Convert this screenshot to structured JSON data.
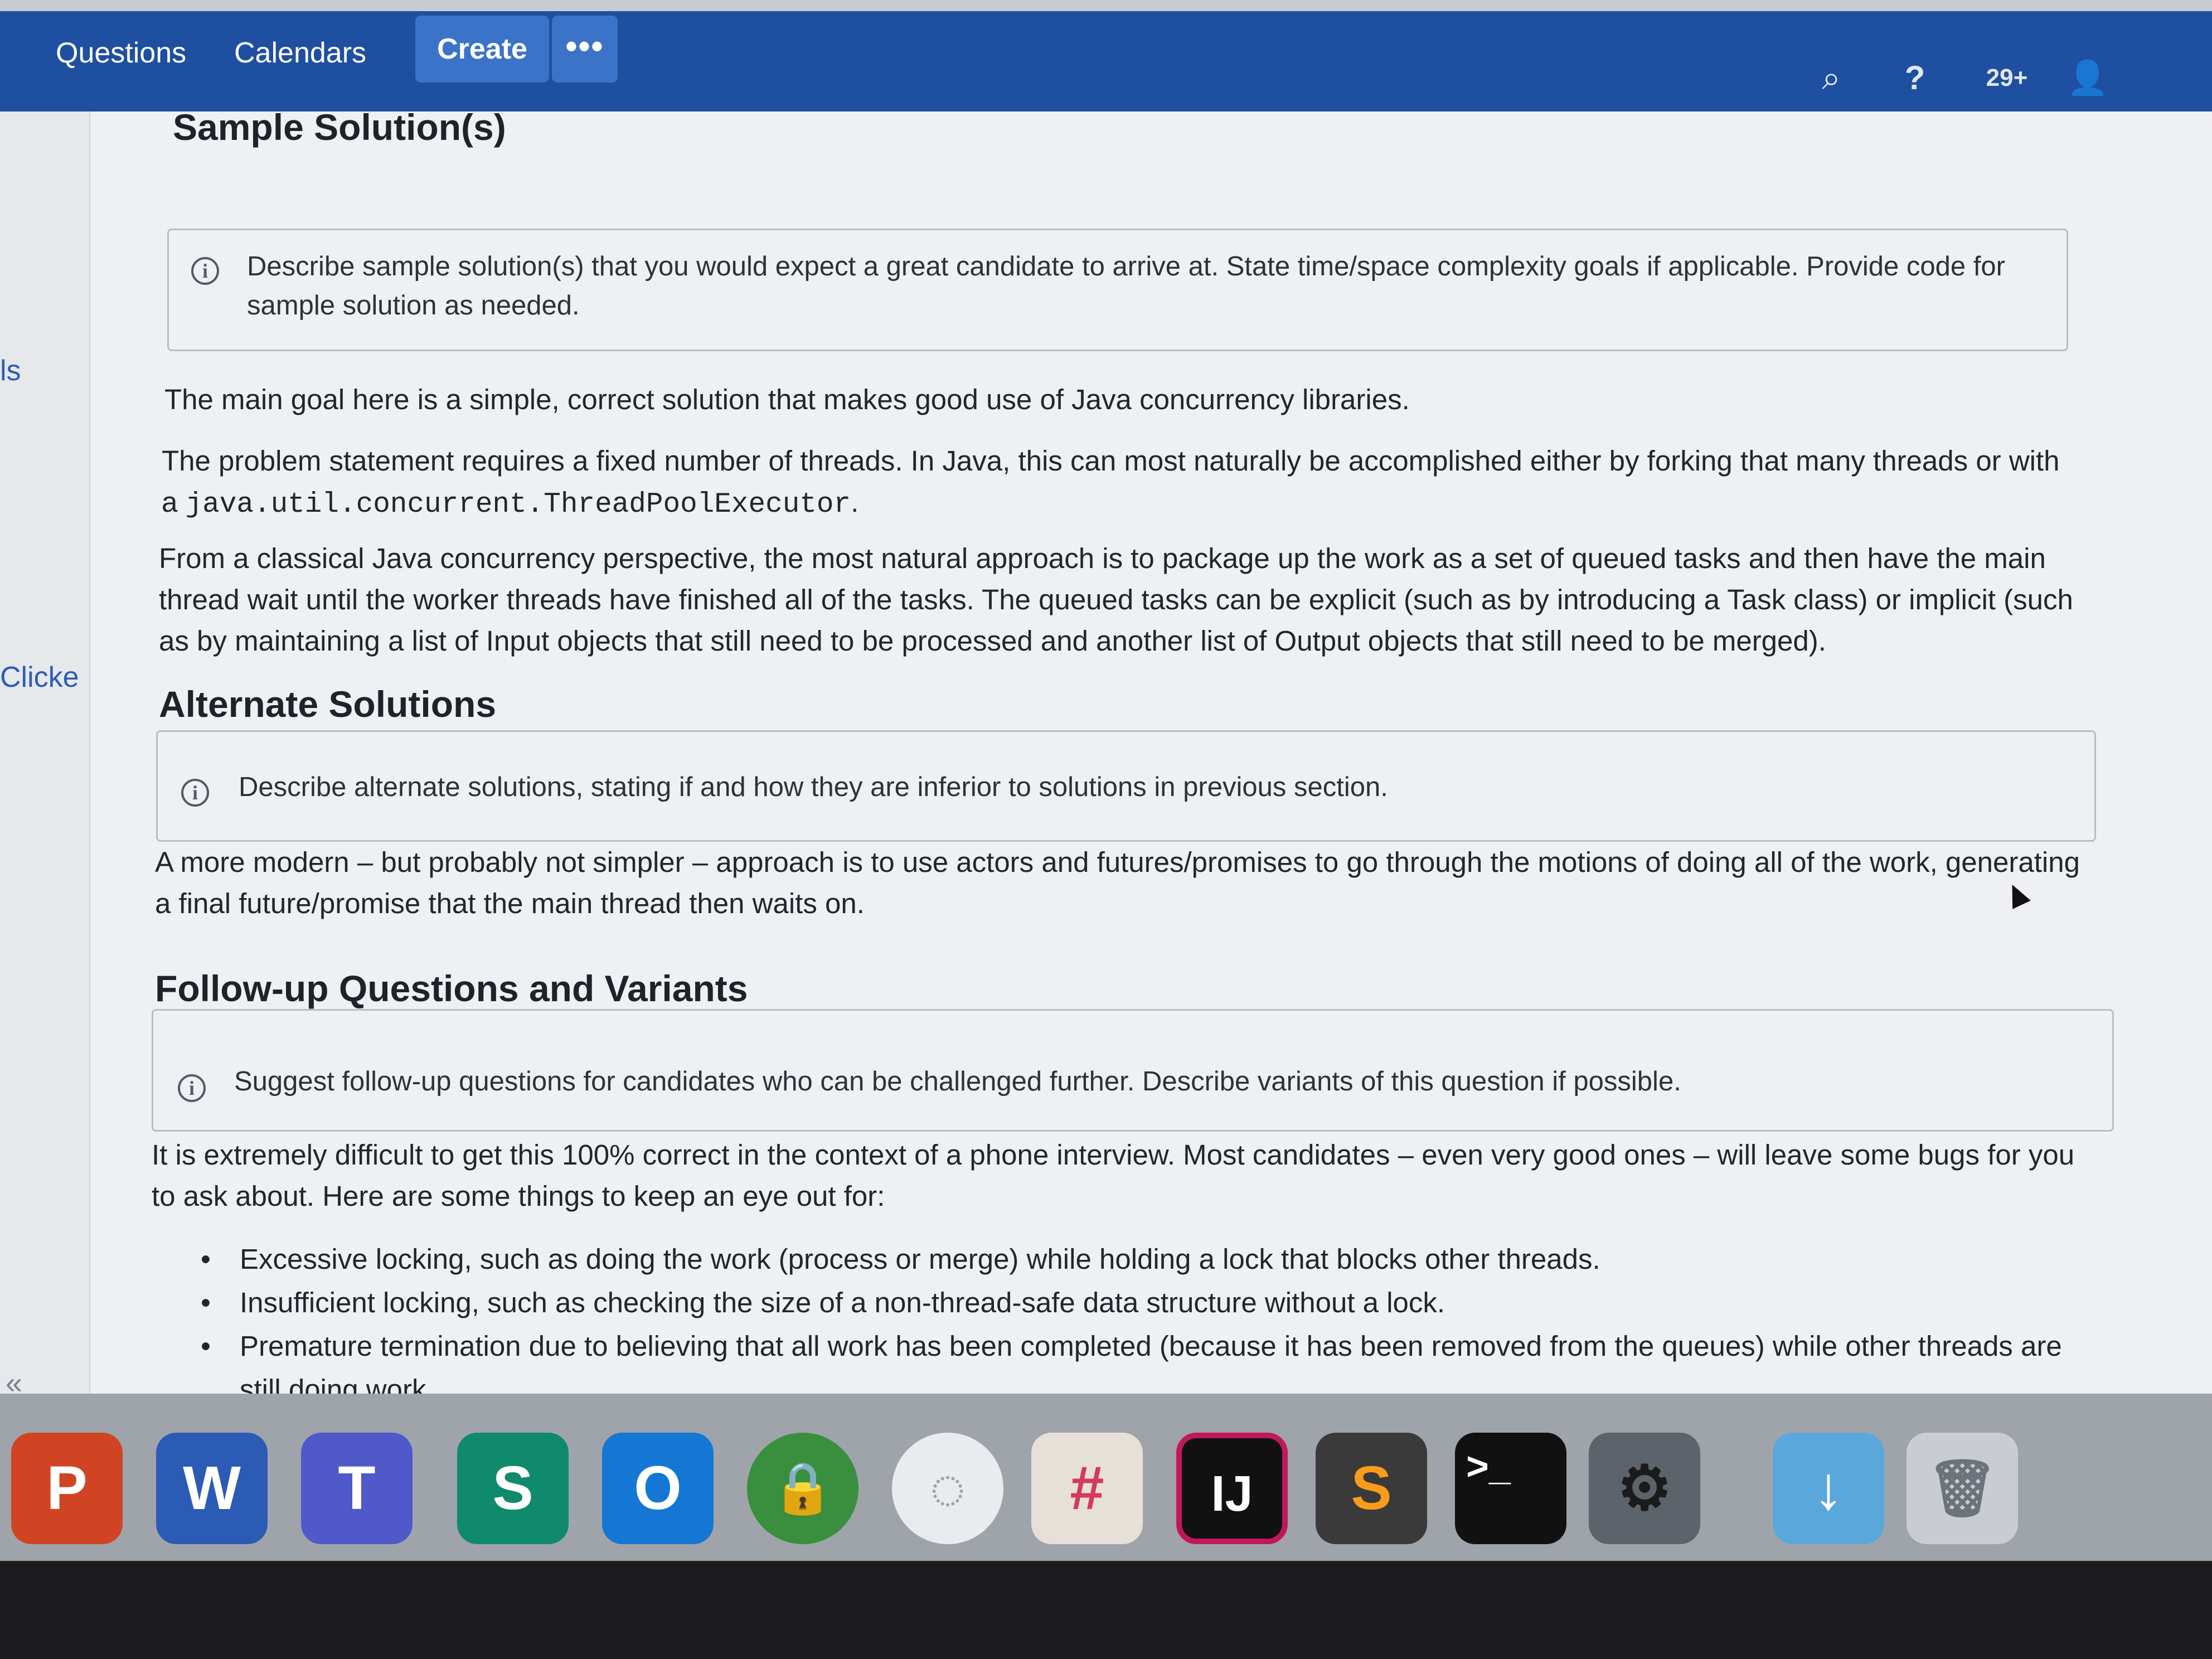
{
  "nav": {
    "items": [
      "Questions",
      "Calendars"
    ],
    "create_label": "Create",
    "more_label": "•••"
  },
  "top_icons": {
    "search": "⌕",
    "help": "?",
    "notifications": "29+",
    "user": "👤"
  },
  "leftbar": {
    "fragment_1": "ls",
    "fragment_2": "Clicke",
    "collapse": "«"
  },
  "sections": {
    "sample": {
      "title": "Sample Solution(s)",
      "info": "Describe sample solution(s) that you would expect a great candidate to arrive at. State time/space complexity goals if applicable. Provide code for sample solution as needed.",
      "p1": "The main goal here is a simple, correct solution that makes good use of Java concurrency libraries.",
      "p2_text": "The problem statement requires a fixed number of threads. In Java, this can most naturally be accomplished either by forking that many threads or with a ",
      "p2_code": "java.util.concurrent.ThreadPoolExecutor",
      "p2_end": ".",
      "p3": "From a classical Java concurrency perspective, the most natural approach is to package up the work as a set of queued tasks and then have the main thread wait until the worker threads have finished all of the tasks. The queued tasks can be explicit (such as by introducing a Task class) or implicit (such as by maintaining a list of Input objects that still need to be processed and another list of Output objects that still need to be merged)."
    },
    "alternate": {
      "title": "Alternate Solutions",
      "info": "Describe alternate solutions, stating if and how they are inferior to solutions in previous section.",
      "p1": "A more modern – but probably not simpler – approach is to use actors and futures/promises to go through the motions of doing all of the work, generating a final future/promise that the main thread then waits on."
    },
    "followup": {
      "title": "Follow-up Questions and Variants",
      "info": "Suggest follow-up questions for candidates who can be challenged further. Describe variants of this question if possible.",
      "p1": "It is extremely difficult to get this 100% correct in the context of a phone interview. Most candidates – even very good ones – will leave some bugs for you to ask about.  Here are some things to keep an eye out for:",
      "bullets": [
        "Excessive locking, such as doing the work (process or merge) while holding a lock that blocks other threads.",
        "Insufficient locking, such as checking the size of a non-thread-safe data structure without a lock.",
        "Premature termination due to believing that all work has been completed (because it has been removed from the queues) while other threads are still doing work."
      ]
    }
  },
  "dock": {
    "apps": [
      {
        "name": "powerpoint",
        "glyph": "P",
        "color": "#d04423"
      },
      {
        "name": "word",
        "glyph": "W",
        "color": "#2b5bb5"
      },
      {
        "name": "teams",
        "glyph": "T",
        "color": "#5059c9"
      },
      {
        "name": "sway",
        "glyph": "S",
        "color": "#0f8a6c"
      },
      {
        "name": "outlook",
        "glyph": "O",
        "color": "#1477d4"
      },
      {
        "name": "vpn",
        "glyph": "🔒",
        "color": "#3a8f3f"
      },
      {
        "name": "wifi",
        "glyph": "◌",
        "color": "#e9ebee"
      },
      {
        "name": "slack",
        "glyph": "#",
        "color": "#e6e0d8"
      },
      {
        "name": "intellij",
        "glyph": "IJ",
        "color": "#111111"
      },
      {
        "name": "sublime",
        "glyph": "S",
        "color": "#3a3a3a"
      },
      {
        "name": "terminal",
        "glyph": ">_",
        "color": "#111111"
      },
      {
        "name": "system-preferences",
        "glyph": "⚙",
        "color": "#5d636b"
      },
      {
        "name": "downloads",
        "glyph": "↓",
        "color": "#5aa7dc"
      },
      {
        "name": "trash",
        "glyph": "🗑",
        "color": "#c9ccd1"
      }
    ]
  }
}
